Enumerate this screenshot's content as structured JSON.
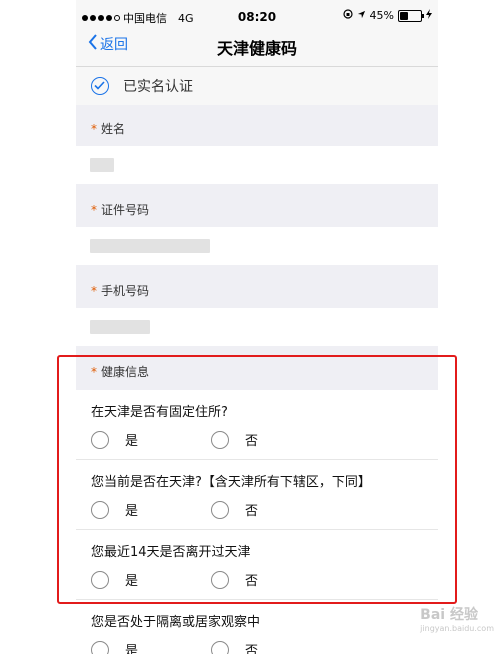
{
  "status_bar": {
    "carrier": "中国电信",
    "network": "4G",
    "time": "08:20",
    "battery": "45%",
    "battery_level": 0.45
  },
  "nav": {
    "back_label": "返回",
    "title": "天津健康码"
  },
  "verified": {
    "label": "已实名认证"
  },
  "form": {
    "name_label": "姓名",
    "id_label": "证件号码",
    "phone_label": "手机号码",
    "health_label": "健康信息",
    "required_mark": "*"
  },
  "questions": [
    {
      "text": "在天津是否有固定住所?",
      "yes": "是",
      "no": "否"
    },
    {
      "text": "您当前是否在天津?【含天津所有下辖区，下同】",
      "yes": "是",
      "no": "否"
    },
    {
      "text": "您最近14天是否离开过天津",
      "yes": "是",
      "no": "否"
    },
    {
      "text": "您是否处于隔离或居家观察中",
      "yes": "是",
      "no": "否"
    }
  ],
  "watermark": {
    "brand": "Bai 经验",
    "sub": "jingyan.baidu.com"
  }
}
